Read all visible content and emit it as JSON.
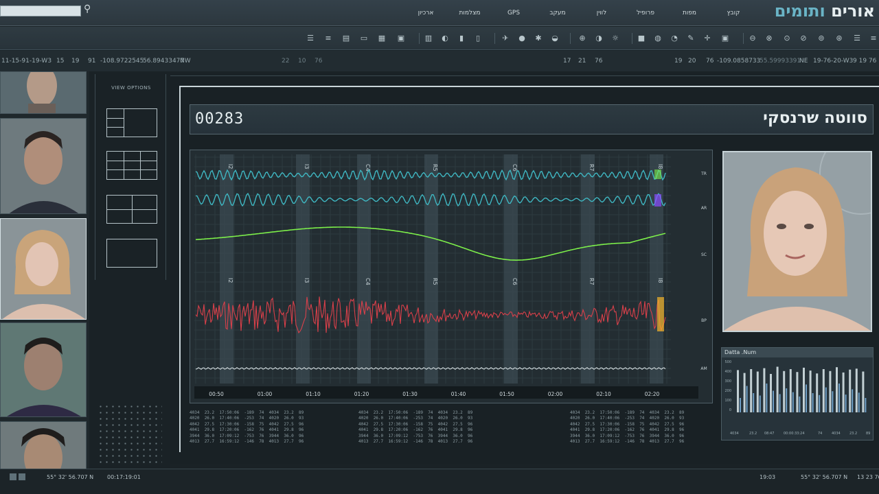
{
  "header": {
    "brand_part1": "אורים",
    "brand_part2": "ותומים",
    "nav": [
      "קובץ",
      "מפות",
      "פרופיל",
      "לווין",
      "מעקב",
      "GPS",
      "מצלמות",
      "ארכיון"
    ]
  },
  "coords_left": {
    "id": "11-15-91-19-W3",
    "a": "15",
    "b": "19",
    "c": "91",
    "lon": "-108.9722545",
    "lat": "56.89433477",
    "dir": "NW"
  },
  "coords_mid": {
    "a": "22",
    "b": "10",
    "c": "76",
    "d": "17",
    "e": "21",
    "f": "76"
  },
  "coords_right": {
    "a": "19",
    "b": "20",
    "c": "76",
    "lon": "-109.0858733",
    "lat": "55.59993391",
    "dir": "NE",
    "id": "19-76-20-W3",
    "tail": "9 19 76"
  },
  "view_options": {
    "title": "VIEW OPTIONS"
  },
  "record": {
    "id": "00283",
    "name": "סווטה שרנסקי"
  },
  "chart_data": {
    "type": "line",
    "x_ticks": [
      "00:50",
      "01:00",
      "01:10",
      "01:20",
      "01:30",
      "01:40",
      "01:50",
      "02:00",
      "02:10",
      "02:20"
    ],
    "channel_labels": [
      "TR",
      "AR",
      "SC",
      "BP",
      "AM"
    ],
    "markers_top": [
      "I2",
      "I3",
      "C4",
      "R5",
      "C6",
      "R7",
      "I8"
    ],
    "markers_mid": [
      "I2",
      "I3",
      "C4",
      "R5",
      "C6",
      "R7",
      "I8"
    ],
    "series_colors": {
      "tr": "#3fb7c2",
      "ar": "#3fb7c2",
      "sc": "#7df04a",
      "bp": "#d9404a",
      "am": "#c9d3d6"
    },
    "grid": true
  },
  "datta": {
    "title": "Datta .Num",
    "y_ticks": [
      "500",
      "400",
      "300",
      "200",
      "100",
      "0"
    ],
    "bars": [
      0.88,
      0.82,
      0.9,
      0.85,
      0.92,
      0.8,
      0.95,
      0.86,
      0.9,
      0.84,
      0.93,
      0.87,
      0.81,
      0.9,
      0.86,
      0.94,
      0.83,
      0.89,
      0.91,
      0.85
    ],
    "inner": [
      0.3,
      0.55,
      0.4,
      0.35,
      0.6,
      0.45,
      0.38,
      0.5,
      0.42,
      0.33,
      0.58,
      0.4,
      0.36,
      0.52,
      0.44,
      0.6,
      0.37,
      0.48,
      0.41,
      0.3
    ],
    "footer": [
      "4034",
      "23.2",
      "08:47",
      "00:00:33:24",
      "74",
      "4034",
      "23.2",
      "89"
    ]
  },
  "table": {
    "rows": [
      [
        "4034",
        "23.2",
        "17:50:06",
        "-189",
        "74",
        "4034",
        "23.2",
        "89"
      ],
      [
        "4020",
        "26.0",
        "17:40:06",
        "-253",
        "74",
        "4020",
        "26.0",
        "93"
      ],
      [
        "4042",
        "27.5",
        "17:30:06",
        "-158",
        "75",
        "4042",
        "27.5",
        "96"
      ],
      [
        "4041",
        "29.8",
        "17:20:06",
        "-162",
        "76",
        "4041",
        "29.8",
        "96"
      ],
      [
        "3944",
        "36.0",
        "17:09:12",
        "-753",
        "76",
        "3944",
        "36.0",
        "96"
      ],
      [
        "4013",
        "27.7",
        "16:59:12",
        "-146",
        "78",
        "4013",
        "27.7",
        "96"
      ]
    ]
  },
  "bottom": {
    "coord_left": "55° 32' 56.707 N",
    "time": "00:17:19:01",
    "clock": "19:03",
    "coord_right": "55° 32' 56.707 N",
    "tail": "13 23 76"
  }
}
